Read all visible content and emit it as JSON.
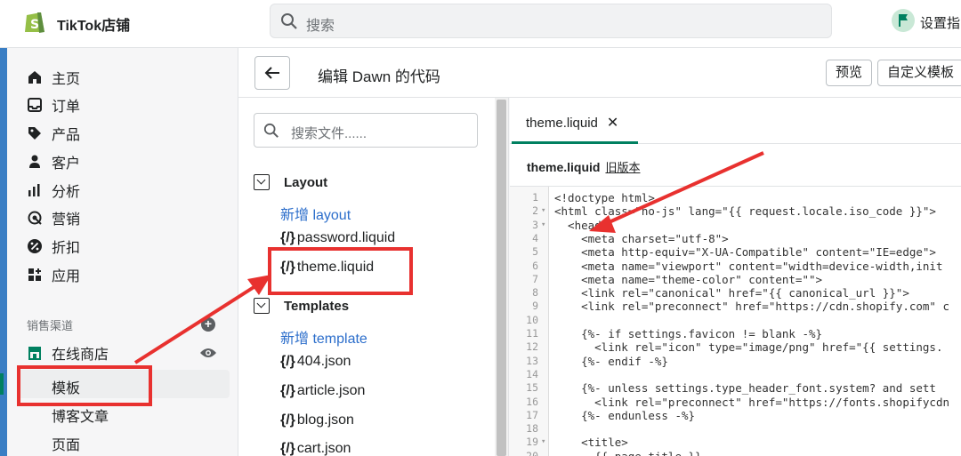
{
  "topbar": {
    "brand": "TikTok店铺",
    "search_placeholder": "搜索",
    "setup_label": "设置指"
  },
  "sidebar": {
    "items": [
      {
        "label": "主页",
        "icon": "home-icon"
      },
      {
        "label": "订单",
        "icon": "inbox-icon"
      },
      {
        "label": "产品",
        "icon": "tag-icon"
      },
      {
        "label": "客户",
        "icon": "person-icon"
      },
      {
        "label": "分析",
        "icon": "bar-chart-icon"
      },
      {
        "label": "营销",
        "icon": "target-icon"
      },
      {
        "label": "折扣",
        "icon": "discount-icon"
      },
      {
        "label": "应用",
        "icon": "apps-icon"
      }
    ],
    "sales_channels_label": "销售渠道",
    "online_store": "在线商店",
    "sub_items": [
      "模板",
      "博客文章",
      "页面"
    ]
  },
  "editor": {
    "title": "编辑 Dawn 的代码",
    "preview_label": "预览",
    "customize_label": "自定义模板"
  },
  "files": {
    "search_placeholder": "搜索文件......",
    "layout_folder": "Layout",
    "layout_add": "新增 layout",
    "layout_files": [
      "password.liquid",
      "theme.liquid"
    ],
    "templates_folder": "Templates",
    "templates_add": "新增 template",
    "template_files": [
      "404.json",
      "article.json",
      "blog.json",
      "cart.json"
    ],
    "file_prefix": "{/}"
  },
  "code": {
    "tab_label": "theme.liquid",
    "tab_close": "✕",
    "header_file": "theme.liquid",
    "header_old": "旧版本",
    "lines": [
      {
        "n": "1",
        "text": "<!doctype html>"
      },
      {
        "n": "2",
        "text": "<html class=\"no-js\" lang=\"{{ request.locale.iso_code }}\">"
      },
      {
        "n": "3",
        "text": "  <head>"
      },
      {
        "n": "4",
        "text": "    <meta charset=\"utf-8\">"
      },
      {
        "n": "5",
        "text": "    <meta http-equiv=\"X-UA-Compatible\" content=\"IE=edge\">"
      },
      {
        "n": "6",
        "text": "    <meta name=\"viewport\" content=\"width=device-width,init"
      },
      {
        "n": "7",
        "text": "    <meta name=\"theme-color\" content=\"\">"
      },
      {
        "n": "8",
        "text": "    <link rel=\"canonical\" href=\"{{ canonical_url }}\">"
      },
      {
        "n": "9",
        "text": "    <link rel=\"preconnect\" href=\"https://cdn.shopify.com\" c"
      },
      {
        "n": "10",
        "text": ""
      },
      {
        "n": "11",
        "text": "    {%- if settings.favicon != blank -%}"
      },
      {
        "n": "12",
        "text": "      <link rel=\"icon\" type=\"image/png\" href=\"{{ settings."
      },
      {
        "n": "13",
        "text": "    {%- endif -%}"
      },
      {
        "n": "14",
        "text": ""
      },
      {
        "n": "15",
        "text": "    {%- unless settings.type_header_font.system? and sett"
      },
      {
        "n": "16",
        "text": "      <link rel=\"preconnect\" href=\"https://fonts.shopifycdn"
      },
      {
        "n": "17",
        "text": "    {%- endunless -%}"
      },
      {
        "n": "18",
        "text": ""
      },
      {
        "n": "19",
        "text": "    <title>"
      },
      {
        "n": "20",
        "text": "      {{ page_title }}"
      }
    ]
  }
}
